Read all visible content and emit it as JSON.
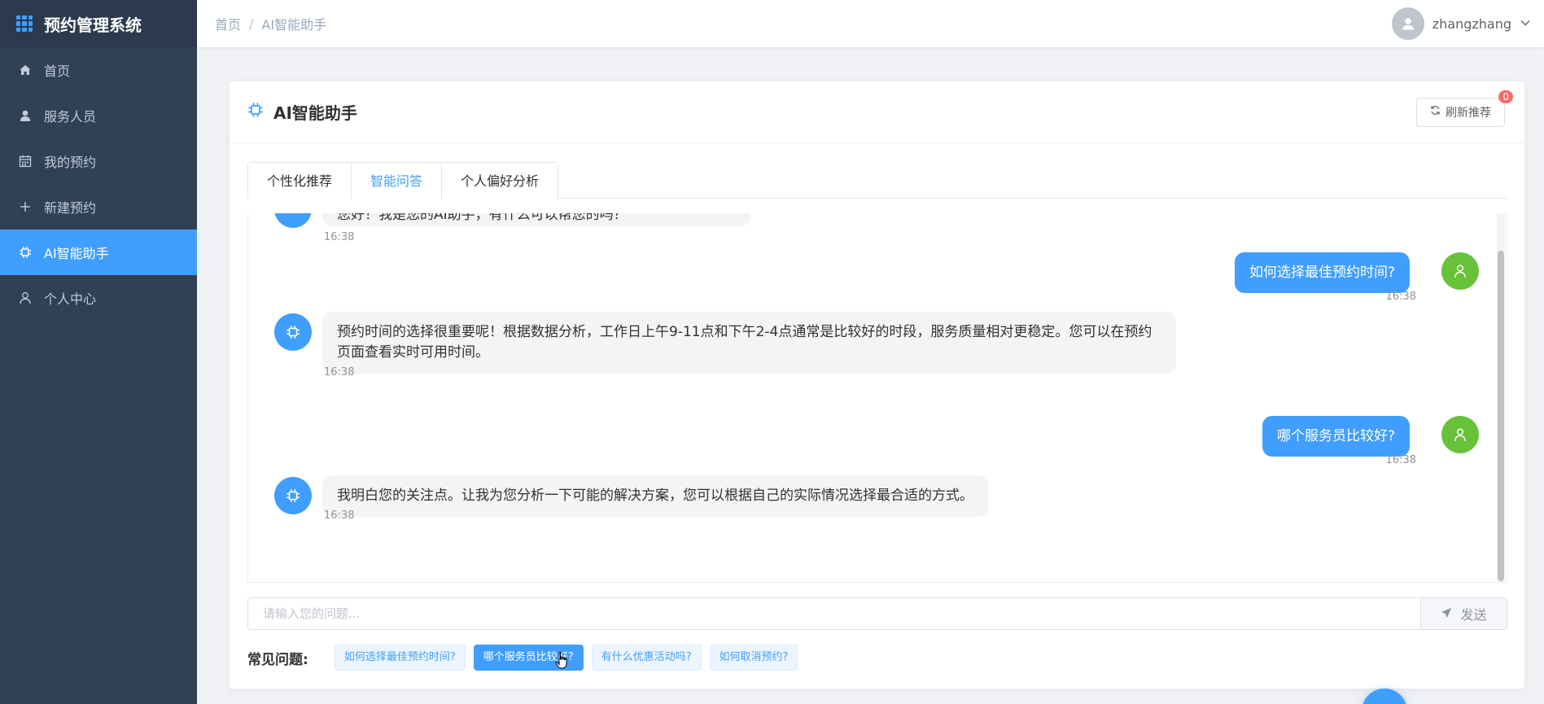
{
  "app": {
    "title": "预约管理系统"
  },
  "sidebar": {
    "items": [
      {
        "label": "首页",
        "icon": "home-icon"
      },
      {
        "label": "服务人员",
        "icon": "user-icon"
      },
      {
        "label": "我的预约",
        "icon": "calendar-icon"
      },
      {
        "label": "新建预约",
        "icon": "plus-icon"
      },
      {
        "label": "AI智能助手",
        "icon": "chip-icon",
        "active": true
      },
      {
        "label": "个人中心",
        "icon": "person-icon"
      }
    ]
  },
  "header": {
    "breadcrumb": [
      "首页",
      "AI智能助手"
    ],
    "breadcrumb_separator": "/",
    "username": "zhangzhang"
  },
  "card": {
    "title": "AI智能助手",
    "refresh_label": "刷新推荐",
    "badge_count": "0"
  },
  "tabs": [
    {
      "label": "个性化推荐"
    },
    {
      "label": "智能问答",
      "active": true
    },
    {
      "label": "个人偏好分析"
    }
  ],
  "chat": {
    "messages": [
      {
        "role": "bot",
        "text": "您好！我是您的AI助手，有什么可以帮您的吗？",
        "time": "16:38"
      },
      {
        "role": "user",
        "text": "如何选择最佳预约时间?",
        "time": "16:38"
      },
      {
        "role": "bot",
        "text": "预约时间的选择很重要呢！根据数据分析，工作日上午9-11点和下午2-4点通常是比较好的时段，服务质量相对更稳定。您可以在预约页面查看实时可用时间。",
        "time": "16:38"
      },
      {
        "role": "user",
        "text": "哪个服务员比较好?",
        "time": "16:38"
      },
      {
        "role": "bot",
        "text": "我明白您的关注点。让我为您分析一下可能的解决方案，您可以根据自己的实际情况选择最合适的方式。",
        "time": "16:38"
      }
    ]
  },
  "input": {
    "placeholder": "请输入您的问题...",
    "value": "",
    "send_label": "发送"
  },
  "faq": {
    "label": "常见问题:",
    "items": [
      "如何选择最佳预约时间?",
      "哪个服务员比较好?",
      "有什么优惠活动吗?",
      "如何取消预约?"
    ]
  },
  "colors": {
    "sidebar_bg": "#304156",
    "primary": "#409eff",
    "user_avatar": "#67c23a",
    "badge": "#f56c6c"
  }
}
